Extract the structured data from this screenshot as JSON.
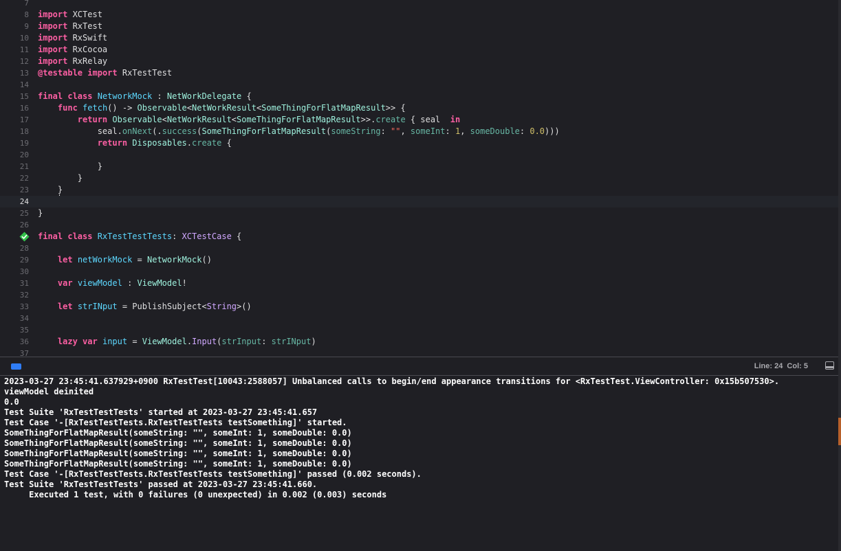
{
  "editor": {
    "lines": [
      {
        "num": "7",
        "tokens": []
      },
      {
        "num": "8",
        "tokens": [
          {
            "t": "import",
            "c": "kw"
          },
          {
            "t": " XCTest",
            "c": "plain"
          }
        ]
      },
      {
        "num": "9",
        "tokens": [
          {
            "t": "import",
            "c": "kw"
          },
          {
            "t": " RxTest",
            "c": "plain"
          }
        ]
      },
      {
        "num": "10",
        "tokens": [
          {
            "t": "import",
            "c": "kw"
          },
          {
            "t": " RxSwift",
            "c": "plain"
          }
        ]
      },
      {
        "num": "11",
        "tokens": [
          {
            "t": "import",
            "c": "kw"
          },
          {
            "t": " RxCocoa",
            "c": "plain"
          }
        ]
      },
      {
        "num": "12",
        "tokens": [
          {
            "t": "import",
            "c": "kw"
          },
          {
            "t": " RxRelay",
            "c": "plain"
          }
        ]
      },
      {
        "num": "13",
        "tokens": [
          {
            "t": "@testable",
            "c": "kw"
          },
          {
            "t": " ",
            "c": "plain"
          },
          {
            "t": "import",
            "c": "kw"
          },
          {
            "t": " RxTestTest",
            "c": "plain"
          }
        ]
      },
      {
        "num": "14",
        "tokens": []
      },
      {
        "num": "15",
        "tokens": [
          {
            "t": "final",
            "c": "kw"
          },
          {
            "t": " ",
            "c": "plain"
          },
          {
            "t": "class",
            "c": "kw"
          },
          {
            "t": " ",
            "c": "plain"
          },
          {
            "t": "NetworkMock",
            "c": "type"
          },
          {
            "t": " : ",
            "c": "plain"
          },
          {
            "t": "NetWorkDelegate",
            "c": "proj"
          },
          {
            "t": " {",
            "c": "plain"
          }
        ]
      },
      {
        "num": "16",
        "tokens": [
          {
            "t": "    ",
            "c": "plain"
          },
          {
            "t": "func",
            "c": "kw"
          },
          {
            "t": " ",
            "c": "plain"
          },
          {
            "t": "fetch",
            "c": "type"
          },
          {
            "t": "() -> ",
            "c": "plain"
          },
          {
            "t": "Observable",
            "c": "proj"
          },
          {
            "t": "<",
            "c": "plain"
          },
          {
            "t": "NetWorkResult",
            "c": "proj"
          },
          {
            "t": "<",
            "c": "plain"
          },
          {
            "t": "SomeThingForFlatMapResult",
            "c": "proj"
          },
          {
            "t": ">> {",
            "c": "plain"
          }
        ]
      },
      {
        "num": "17",
        "tokens": [
          {
            "t": "        ",
            "c": "plain"
          },
          {
            "t": "return",
            "c": "kw"
          },
          {
            "t": " ",
            "c": "plain"
          },
          {
            "t": "Observable",
            "c": "proj"
          },
          {
            "t": "<",
            "c": "plain"
          },
          {
            "t": "NetWorkResult",
            "c": "proj"
          },
          {
            "t": "<",
            "c": "plain"
          },
          {
            "t": "SomeThingForFlatMapResult",
            "c": "proj"
          },
          {
            "t": ">>.",
            "c": "plain"
          },
          {
            "t": "create",
            "c": "func"
          },
          {
            "t": " { seal  ",
            "c": "plain"
          },
          {
            "t": "in",
            "c": "kw"
          }
        ]
      },
      {
        "num": "18",
        "tokens": [
          {
            "t": "            seal.",
            "c": "plain"
          },
          {
            "t": "onNext",
            "c": "func"
          },
          {
            "t": "(.",
            "c": "plain"
          },
          {
            "t": "success",
            "c": "func"
          },
          {
            "t": "(",
            "c": "plain"
          },
          {
            "t": "SomeThingForFlatMapResult",
            "c": "proj"
          },
          {
            "t": "(",
            "c": "plain"
          },
          {
            "t": "someString",
            "c": "func"
          },
          {
            "t": ": ",
            "c": "plain"
          },
          {
            "t": "\"\"",
            "c": "str"
          },
          {
            "t": ", ",
            "c": "plain"
          },
          {
            "t": "someInt",
            "c": "func"
          },
          {
            "t": ": ",
            "c": "plain"
          },
          {
            "t": "1",
            "c": "num"
          },
          {
            "t": ", ",
            "c": "plain"
          },
          {
            "t": "someDouble",
            "c": "func"
          },
          {
            "t": ": ",
            "c": "plain"
          },
          {
            "t": "0.0",
            "c": "num"
          },
          {
            "t": ")))",
            "c": "plain"
          }
        ]
      },
      {
        "num": "19",
        "tokens": [
          {
            "t": "            ",
            "c": "plain"
          },
          {
            "t": "return",
            "c": "kw"
          },
          {
            "t": " ",
            "c": "plain"
          },
          {
            "t": "Disposables",
            "c": "proj"
          },
          {
            "t": ".",
            "c": "plain"
          },
          {
            "t": "create",
            "c": "func"
          },
          {
            "t": " {",
            "c": "plain"
          }
        ]
      },
      {
        "num": "20",
        "tokens": []
      },
      {
        "num": "21",
        "tokens": [
          {
            "t": "            }",
            "c": "plain"
          }
        ]
      },
      {
        "num": "22",
        "tokens": [
          {
            "t": "        }",
            "c": "plain"
          }
        ]
      },
      {
        "num": "23",
        "tokens": [
          {
            "t": "    }",
            "c": "plain"
          }
        ]
      },
      {
        "num": "24",
        "tokens": [],
        "current": true
      },
      {
        "num": "25",
        "tokens": [
          {
            "t": "}",
            "c": "plain"
          }
        ]
      },
      {
        "num": "26",
        "tokens": []
      },
      {
        "num": "",
        "tokens": [
          {
            "t": "final",
            "c": "kw"
          },
          {
            "t": " ",
            "c": "plain"
          },
          {
            "t": "class",
            "c": "kw"
          },
          {
            "t": " ",
            "c": "plain"
          },
          {
            "t": "RxTestTestTests",
            "c": "type"
          },
          {
            "t": ": ",
            "c": "plain"
          },
          {
            "t": "XCTestCase",
            "c": "lib"
          },
          {
            "t": " {",
            "c": "plain"
          }
        ],
        "badge": true
      },
      {
        "num": "28",
        "tokens": []
      },
      {
        "num": "29",
        "tokens": [
          {
            "t": "    ",
            "c": "plain"
          },
          {
            "t": "let",
            "c": "kw"
          },
          {
            "t": " ",
            "c": "plain"
          },
          {
            "t": "netWorkMock",
            "c": "type"
          },
          {
            "t": " = ",
            "c": "plain"
          },
          {
            "t": "NetworkMock",
            "c": "proj"
          },
          {
            "t": "()",
            "c": "plain"
          }
        ]
      },
      {
        "num": "30",
        "tokens": []
      },
      {
        "num": "31",
        "tokens": [
          {
            "t": "    ",
            "c": "plain"
          },
          {
            "t": "var",
            "c": "kw"
          },
          {
            "t": " ",
            "c": "plain"
          },
          {
            "t": "viewModel",
            "c": "type"
          },
          {
            "t": " : ",
            "c": "plain"
          },
          {
            "t": "ViewModel",
            "c": "proj"
          },
          {
            "t": "!",
            "c": "plain"
          }
        ]
      },
      {
        "num": "32",
        "tokens": []
      },
      {
        "num": "33",
        "tokens": [
          {
            "t": "    ",
            "c": "plain"
          },
          {
            "t": "let",
            "c": "kw"
          },
          {
            "t": " ",
            "c": "plain"
          },
          {
            "t": "strINput",
            "c": "type"
          },
          {
            "t": " = PublishSubject<",
            "c": "plain"
          },
          {
            "t": "String",
            "c": "lib"
          },
          {
            "t": ">()",
            "c": "plain"
          }
        ]
      },
      {
        "num": "34",
        "tokens": []
      },
      {
        "num": "35",
        "tokens": []
      },
      {
        "num": "36",
        "tokens": [
          {
            "t": "    ",
            "c": "plain"
          },
          {
            "t": "lazy",
            "c": "kw"
          },
          {
            "t": " ",
            "c": "plain"
          },
          {
            "t": "var",
            "c": "kw"
          },
          {
            "t": " ",
            "c": "plain"
          },
          {
            "t": "input",
            "c": "type"
          },
          {
            "t": " = ",
            "c": "plain"
          },
          {
            "t": "ViewModel",
            "c": "proj"
          },
          {
            "t": ".",
            "c": "plain"
          },
          {
            "t": "Input",
            "c": "lib"
          },
          {
            "t": "(",
            "c": "plain"
          },
          {
            "t": "strInput",
            "c": "func"
          },
          {
            "t": ": ",
            "c": "plain"
          },
          {
            "t": "strINput",
            "c": "func"
          },
          {
            "t": ")",
            "c": "plain"
          }
        ]
      },
      {
        "num": "37",
        "tokens": []
      }
    ],
    "token_colors": {
      "kw": "#fc5fa3",
      "type": "#5dd8ff",
      "lib": "#d0a8ff",
      "proj": "#9ef1dd",
      "func": "#67b7a4",
      "str": "#fc6a5d",
      "num": "#d0bf69",
      "plain": "#dfdfe0"
    },
    "test_status_icon": "checkmark-diamond-icon",
    "test_status_color": "#31c148"
  },
  "status_bar": {
    "cursor_position": "Line: 24  Col: 5",
    "debug_toggle_icon": "debug-area-toggle-icon",
    "panel_toggle_icon": "hide-debug-area-icon",
    "accent": "#2f7df6"
  },
  "console": {
    "lines": [
      "2023-03-27 23:45:41.637929+0900 RxTestTest[10043:2588057] Unbalanced calls to begin/end appearance transitions for <RxTestTest.ViewController: 0x15b507530>.",
      "viewModel deinited",
      "0.0",
      "Test Suite 'RxTestTestTests' started at 2023-03-27 23:45:41.657",
      "Test Case '-[RxTestTestTests.RxTestTestTests testSomething]' started.",
      "SomeThingForFlatMapResult(someString: \"\", someInt: 1, someDouble: 0.0)",
      "SomeThingForFlatMapResult(someString: \"\", someInt: 1, someDouble: 0.0)",
      "SomeThingForFlatMapResult(someString: \"\", someInt: 1, someDouble: 0.0)",
      "SomeThingForFlatMapResult(someString: \"\", someInt: 1, someDouble: 0.0)",
      "Test Case '-[RxTestTestTests.RxTestTestTests testSomething]' passed (0.002 seconds).",
      "Test Suite 'RxTestTestTests' passed at 2023-03-27 23:45:41.660.",
      "     Executed 1 test, with 0 failures (0 unexpected) in 0.002 (0.003) seconds"
    ]
  }
}
